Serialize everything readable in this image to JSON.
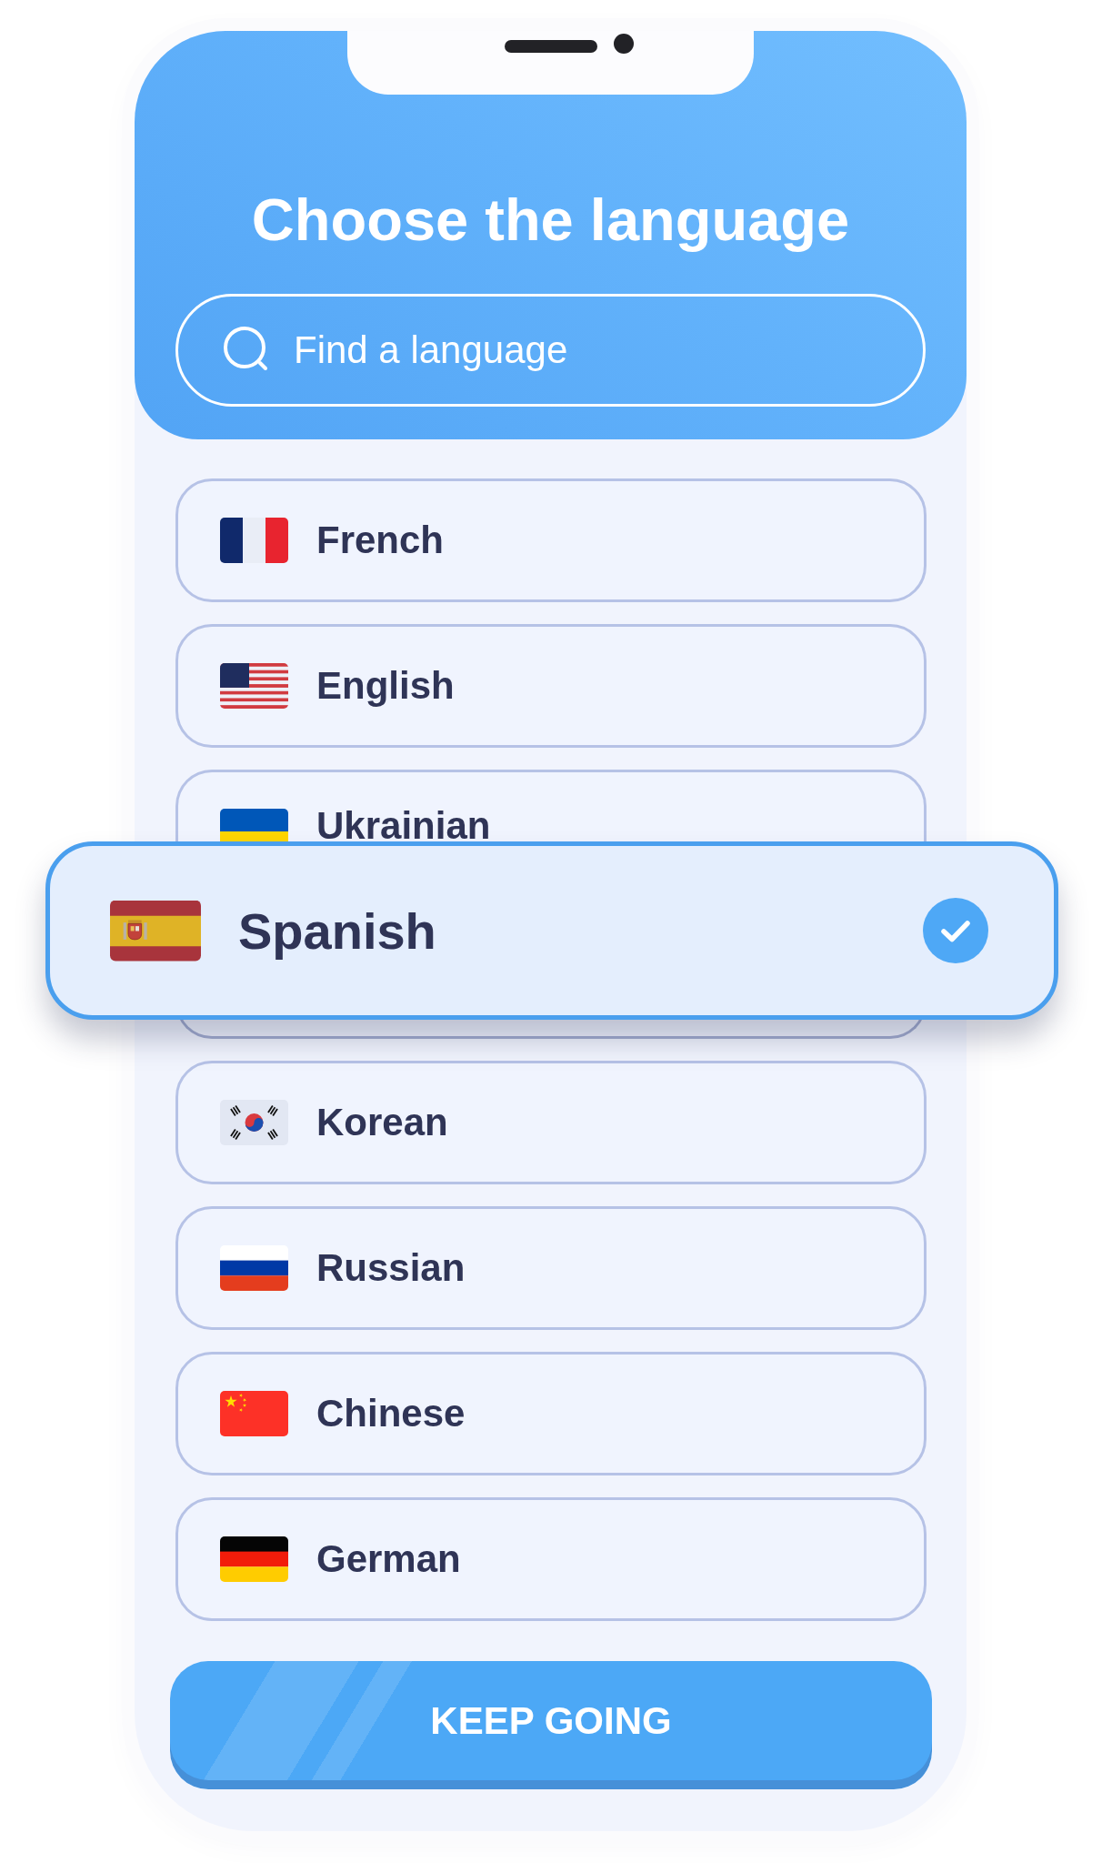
{
  "header": {
    "title": "Choose the language",
    "search": {
      "placeholder": "Find a language"
    }
  },
  "languages": [
    {
      "label": "French",
      "kind": "france",
      "selected": false
    },
    {
      "label": "English",
      "kind": "usa",
      "selected": false
    },
    {
      "label": "Ukrainian",
      "kind": "ukraine",
      "selected": false
    },
    {
      "label": "Spanish",
      "kind": "spain",
      "selected": true
    },
    {
      "label": "Korean",
      "kind": "korea",
      "selected": false
    },
    {
      "label": "Russian",
      "kind": "russia",
      "selected": false
    },
    {
      "label": "Chinese",
      "kind": "china",
      "selected": false
    },
    {
      "label": "German",
      "kind": "germany",
      "selected": false
    }
  ],
  "button": {
    "label": "KEEP GOING"
  }
}
